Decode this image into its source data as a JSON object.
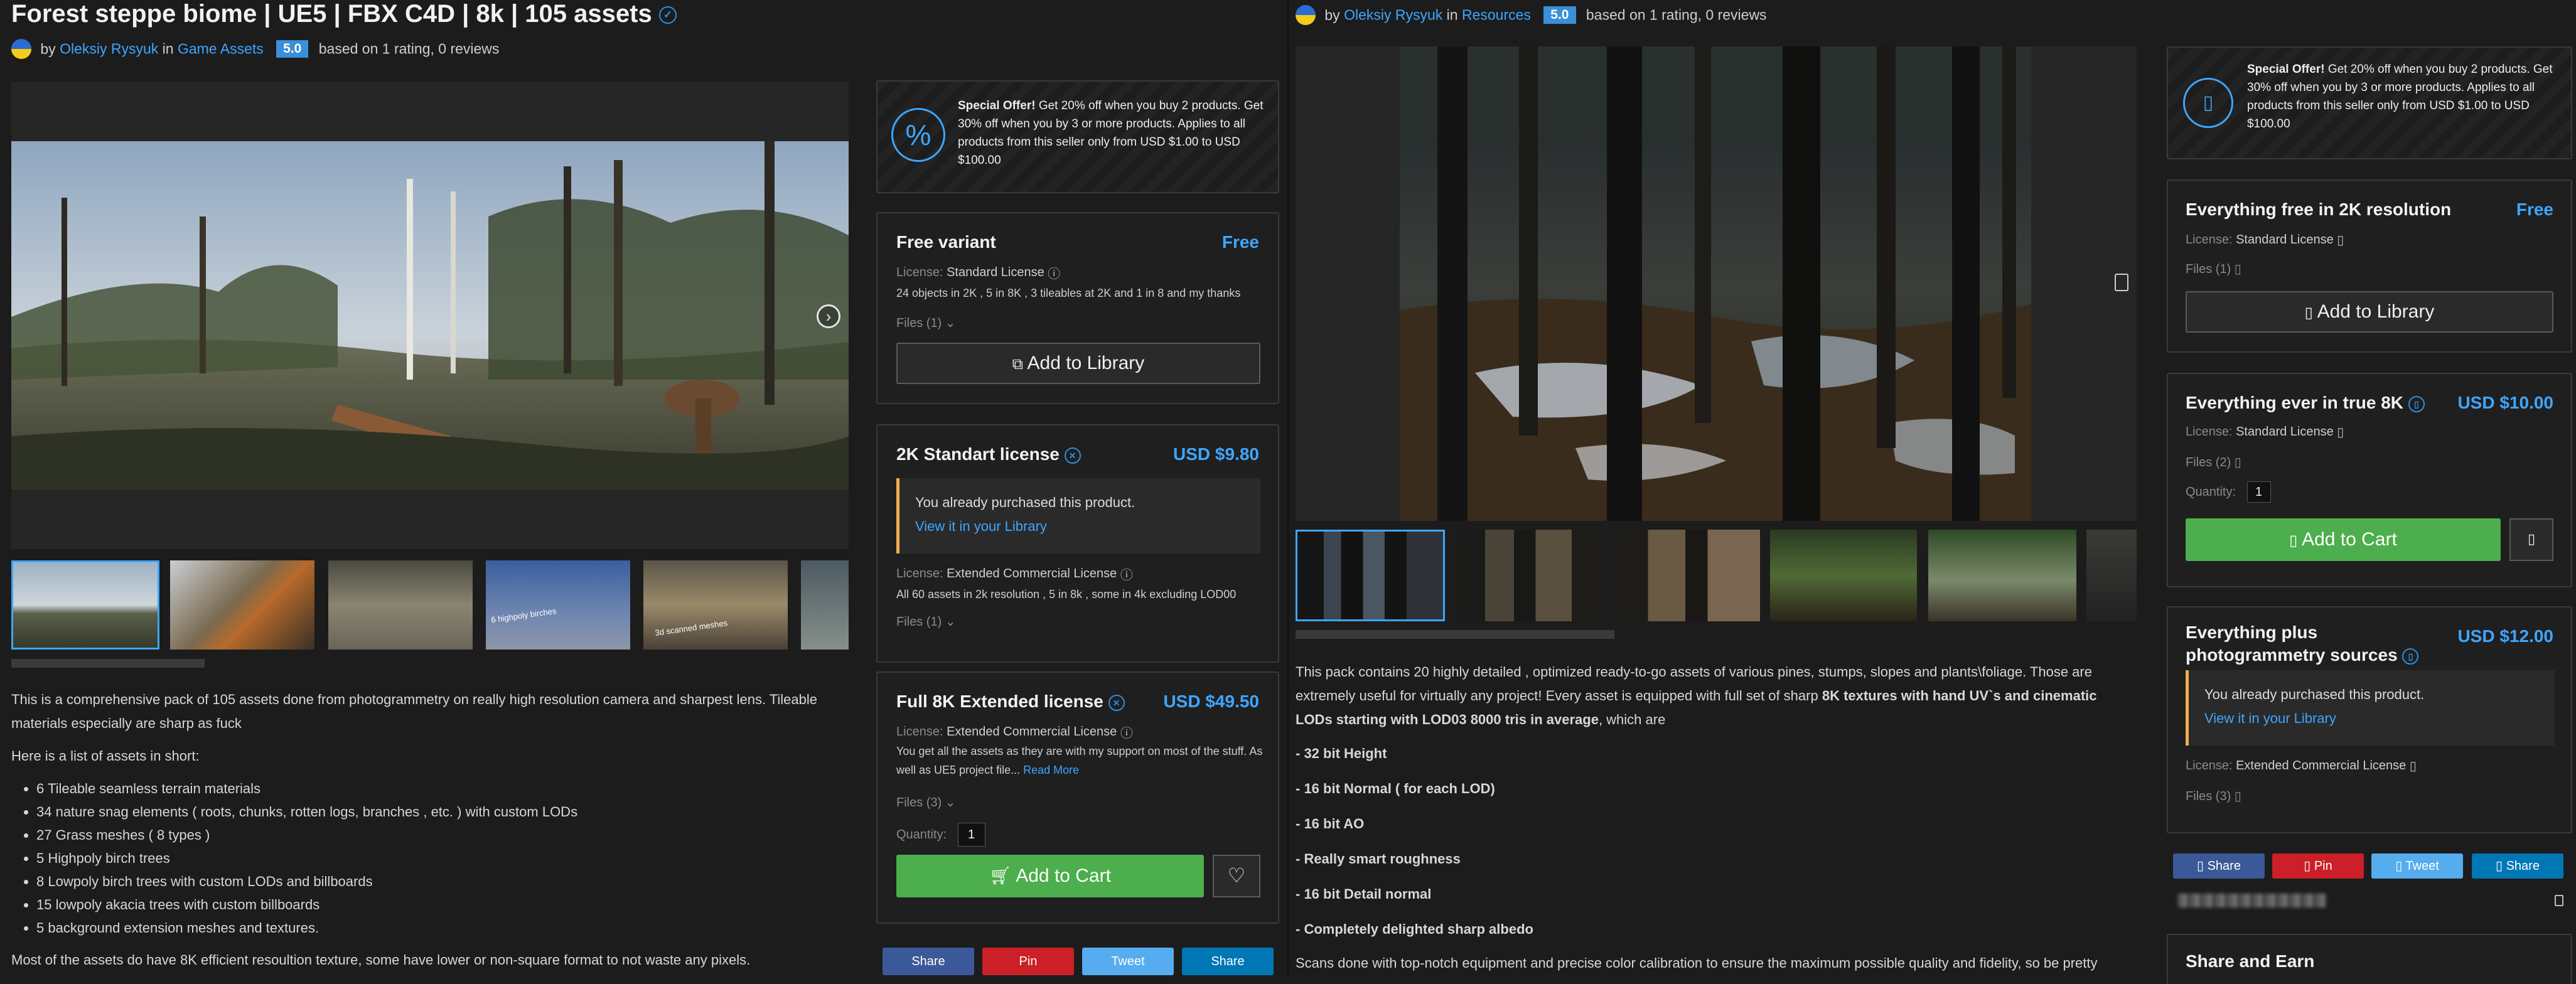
{
  "left": {
    "title": "Forest steppe biome | UE5 | FBX C4D | 8k | 105 assets",
    "author": {
      "by": "by",
      "name": "Oleksiy Rysyuk",
      "in": "in",
      "category": "Game Assets",
      "rating": "5.0",
      "rating_text": "based on 1 rating,  0 reviews"
    },
    "offer": {
      "bold": "Special Offer!",
      "text": " Get 20% off when you buy 2 products. Get 30% off when you by 3 or more products. Applies to all products from this seller only from USD $1.00 to USD $100.00"
    },
    "variants": [
      {
        "title": "Free variant",
        "price": "Free",
        "license_label": "License:",
        "license": "Standard License",
        "desc": "24 objects in 2K , 5 in 8K , 3 tileables at 2K and 1 in 8 and my thanks",
        "files": "Files (1)",
        "button": "Add to Library"
      },
      {
        "title": "2K Standart license",
        "price": "USD $9.80",
        "notice": "You already purchased this product.",
        "notice_link": "View it in your Library",
        "license_label": "License:",
        "license": "Extended Commercial License",
        "desc": "All 60 assets in 2k resolution , 5 in 8k , some in 4k excluding LOD00",
        "files": "Files (1)"
      },
      {
        "title": "Full 8K Extended license",
        "price": "USD $49.50",
        "license_label": "License:",
        "license": "Extended Commercial License",
        "desc": "You get all the assets as they are with my support on most of the stuff. As well as UE5 project file...",
        "read_more": "Read More",
        "files": "Files (3)",
        "qty_label": "Quantity:",
        "qty": "1",
        "button": "Add to Cart"
      }
    ],
    "share": [
      "Share",
      "Pin",
      "Tweet",
      "Share"
    ],
    "thumb_captions": [
      "6 highpoly birches",
      "3d scanned meshes"
    ],
    "description": {
      "intro": "This is a comprehensive pack of 105 assets done from photogrammetry on really high resolution camera and sharpest lens. Tileable materials especially are sharp as fuck",
      "list_title": "Here is a list of assets in short:",
      "items": [
        "6 Tileable seamless terrain materials",
        "34 nature snag elements ( roots, chunks, rotten logs, branches , etc. )  with custom LODs",
        "27 Grass meshes ( 8 types )",
        "5 Highpoly birch trees",
        "8 Lowpoly birch trees with custom LODs and billboards",
        "15 lowpoly akacia trees with custom billboards",
        "5 background extension meshes and textures."
      ],
      "outro": "Most of the assets do have 8K efficient resoultion texture, some have lower or non-square format to not waste any pixels."
    }
  },
  "right": {
    "author": {
      "by": "by",
      "name": "Oleksiy Rysyuk",
      "in": "in",
      "category": "Resources",
      "rating": "5.0",
      "rating_text": "based on 1 rating,  0 reviews"
    },
    "offer": {
      "bold": "Special Offer!",
      "text": " Get 20% off when you buy 2 products. Get 30% off when you by 3 or more products. Applies to all products from this seller only from USD $1.00 to USD $100.00"
    },
    "variants": [
      {
        "title": "Everything free in 2K resolution",
        "price": "Free",
        "license_label": "License:",
        "license": "Standard License",
        "files": "Files (1)",
        "button": "Add to Library"
      },
      {
        "title": "Everything ever in true 8K",
        "price": "USD $10.00",
        "license_label": "License:",
        "license": "Standard License",
        "files": "Files (2)",
        "qty_label": "Quantity:",
        "qty": "1",
        "button": "Add to Cart"
      },
      {
        "title": "Everything plus photogrammetry sources",
        "price": "USD $12.00",
        "notice": "You already purchased this product.",
        "notice_link": "View it in your Library",
        "license_label": "License:",
        "license": "Extended Commercial License",
        "files": "Files (3)"
      }
    ],
    "share": [
      "Share",
      "Pin",
      "Tweet",
      "Share"
    ],
    "share_earn": "Share and Earn",
    "description": {
      "p1_a": "This pack contains 20 highly detailed , optimized ready-to-go assets of various pines, stumps, slopes and plants\\foliage. Those are extremely useful for virtually any project! Every asset is equipped with full set of sharp ",
      "p1_b": "8K textures with hand UV`s and cinematic LODs starting with LOD03 8000 tris in average",
      "p1_c": ", which are",
      "items": [
        "- 32 bit Height",
        "- 16 bit Normal ( for each LOD)",
        "- 16 bit AO",
        "- Really smart roughness",
        "- 16 bit Detail normal",
        "- Completely delighted sharp albedo"
      ],
      "outro": "Scans done with top-notch equipment and precise color calibration to ensure the maximum possible quality and fidelity, so be pretty"
    }
  },
  "colors": {
    "accent": "#3ea6ff",
    "green": "#4cae4c",
    "warning": "#f0ad4e",
    "rating": "#3a8fd8",
    "facebook": "#3b5998",
    "pinterest": "#cb2027",
    "twitter": "#55acee",
    "linkedin": "#0077b5"
  }
}
